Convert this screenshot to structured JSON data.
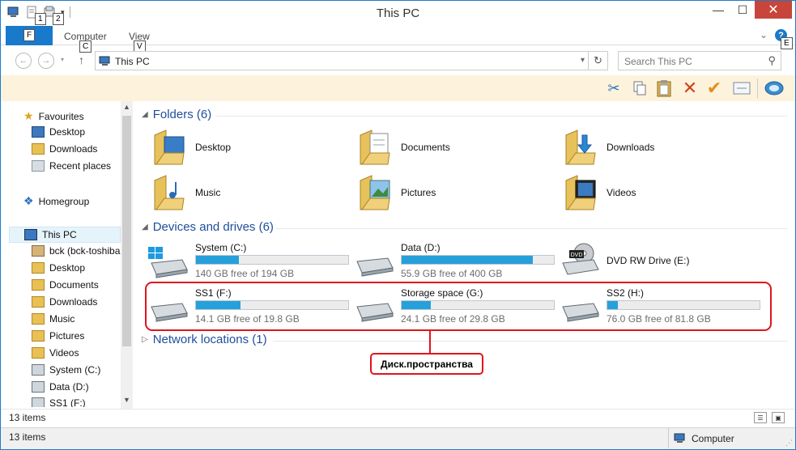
{
  "window": {
    "title": "This PC"
  },
  "keytips": {
    "file": "F",
    "qat1": "1",
    "qat2": "2",
    "computer": "C",
    "view": "V",
    "expand": "E"
  },
  "ribbon": {
    "tabs": [
      "Computer",
      "View"
    ]
  },
  "address": {
    "path": "This PC",
    "search_placeholder": "Search This PC"
  },
  "toolbar": {
    "icons": [
      "cut-icon",
      "copy-icon",
      "paste-icon",
      "delete-icon",
      "check-icon",
      "properties-icon",
      "network-icon"
    ]
  },
  "nav": {
    "items": [
      {
        "label": "Favourites",
        "icon": "star-icon"
      },
      {
        "label": "Desktop",
        "icon": "desktop-icon"
      },
      {
        "label": "Downloads",
        "icon": "downloads-icon"
      },
      {
        "label": "Recent places",
        "icon": "recent-icon"
      },
      {
        "label": "Homegroup",
        "icon": "homegroup-icon"
      },
      {
        "label": "This PC",
        "icon": "computer-icon"
      },
      {
        "label": "bck (bck-toshiba",
        "icon": "user-folder-icon"
      },
      {
        "label": "Desktop",
        "icon": "desktop-icon"
      },
      {
        "label": "Documents",
        "icon": "documents-icon"
      },
      {
        "label": "Downloads",
        "icon": "downloads-icon"
      },
      {
        "label": "Music",
        "icon": "music-icon"
      },
      {
        "label": "Pictures",
        "icon": "pictures-icon"
      },
      {
        "label": "Videos",
        "icon": "videos-icon"
      },
      {
        "label": "System (C:)",
        "icon": "drive-icon"
      },
      {
        "label": "Data (D:)",
        "icon": "drive-icon"
      },
      {
        "label": "SS1 (F:)",
        "icon": "drive-icon"
      }
    ]
  },
  "content": {
    "folders_header": "Folders (6)",
    "folders": [
      "Desktop",
      "Documents",
      "Downloads",
      "Music",
      "Pictures",
      "Videos"
    ],
    "devices_header": "Devices and drives (6)",
    "drives": [
      {
        "name": "System (C:)",
        "free": "140 GB free of 194 GB",
        "used_fraction": 0.28
      },
      {
        "name": "Data (D:)",
        "free": "55.9 GB free of 400 GB",
        "used_fraction": 0.86
      },
      {
        "name": "DVD RW Drive (E:)",
        "free": "",
        "used_fraction": null
      },
      {
        "name": "SS1 (F:)",
        "free": "14.1 GB free of 19.8 GB",
        "used_fraction": 0.29
      },
      {
        "name": "Storage space (G:)",
        "free": "24.1 GB free of 29.8 GB",
        "used_fraction": 0.19
      },
      {
        "name": "SS2 (H:)",
        "free": "76.0 GB free of 81.8 GB",
        "used_fraction": 0.07
      }
    ],
    "network_header": "Network locations (1)",
    "callout": "Диск.пространства",
    "dvd_badge": "DVD"
  },
  "status": {
    "count_top": "13 items",
    "count_bottom": "13 items",
    "zone": "Computer"
  },
  "colors": {
    "accent": "#1979ca",
    "bar_fill": "#26a0da",
    "highlight": "#e0141e",
    "group_header": "#1e4e9c"
  }
}
